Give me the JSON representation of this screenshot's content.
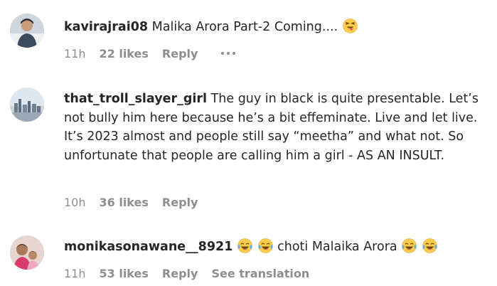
{
  "comments": [
    {
      "username": "kavirajrai08",
      "text_before": " Malika Arora Part-2 Coming....",
      "emoji_1": "winking-tongue-emoji",
      "time": "11h",
      "likes": "22 likes",
      "reply": "Reply"
    },
    {
      "username": "that_troll_slayer_girl",
      "text": " The guy in black is quite presentable. Let’s not bully him here because he’s a bit effeminate. Live and let live. It’s 2023 almost and people still say “meetha” and what not. So unfortunate that people are calling him a girl - AS AN INSULT.",
      "time": "10h",
      "likes": "36 likes",
      "reply": "Reply"
    },
    {
      "username": "monikasonawane__8921",
      "text_middle": " choti Malaika Arora ",
      "emoji_names": [
        "tears-of-joy-emoji",
        "tears-of-joy-emoji",
        "tears-of-joy-emoji",
        "tears-of-joy-emoji"
      ],
      "time": "11h",
      "likes": "53 likes",
      "reply": "Reply",
      "translate": "See translation"
    }
  ],
  "colors": {
    "text": "#262626",
    "meta": "#8e8e8e",
    "emoji_yellow": "#ffcc4d"
  }
}
